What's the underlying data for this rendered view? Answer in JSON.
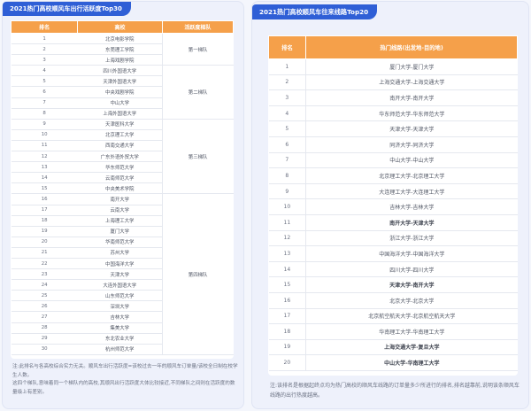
{
  "left": {
    "banner": "2021热门高校顺风车出行活跃度Top30",
    "headers": {
      "rank": "排名",
      "school": "高校",
      "tier": "活跃度梯队"
    },
    "rows": [
      {
        "rank": "1",
        "school": "北京电影学院"
      },
      {
        "rank": "2",
        "school": "东莞理工学院"
      },
      {
        "rank": "3",
        "school": "上海戏剧学院"
      },
      {
        "rank": "4",
        "school": "四川外国语大学"
      },
      {
        "rank": "5",
        "school": "天津外国语大学"
      },
      {
        "rank": "6",
        "school": "中央戏剧学院"
      },
      {
        "rank": "7",
        "school": "中山大学"
      },
      {
        "rank": "8",
        "school": "上海外国语大学"
      },
      {
        "rank": "9",
        "school": "天津医科大学"
      },
      {
        "rank": "10",
        "school": "北京理工大学"
      },
      {
        "rank": "11",
        "school": "西南交通大学"
      },
      {
        "rank": "12",
        "school": "广东外语外贸大学"
      },
      {
        "rank": "13",
        "school": "华东师范大学"
      },
      {
        "rank": "14",
        "school": "云南师范大学"
      },
      {
        "rank": "15",
        "school": "中央美术学院"
      },
      {
        "rank": "16",
        "school": "南开大学"
      },
      {
        "rank": "17",
        "school": "云南大学"
      },
      {
        "rank": "18",
        "school": "上海理工大学"
      },
      {
        "rank": "19",
        "school": "厦门大学"
      },
      {
        "rank": "20",
        "school": "华南师范大学"
      },
      {
        "rank": "21",
        "school": "苏州大学"
      },
      {
        "rank": "22",
        "school": "中国海洋大学"
      },
      {
        "rank": "23",
        "school": "天津大学"
      },
      {
        "rank": "24",
        "school": "大连外国语大学"
      },
      {
        "rank": "25",
        "school": "山东师范大学"
      },
      {
        "rank": "26",
        "school": "深圳大学"
      },
      {
        "rank": "27",
        "school": "吉林大学"
      },
      {
        "rank": "28",
        "school": "集美大学"
      },
      {
        "rank": "29",
        "school": "东北农业大学"
      },
      {
        "rank": "30",
        "school": "杭州师范大学"
      }
    ],
    "tiers": [
      {
        "label": "第一梯队",
        "span": 3
      },
      {
        "label": "第二梯队",
        "span": 5
      },
      {
        "label": "第三梯队",
        "span": 7
      },
      {
        "label": "第四梯队",
        "span": 15
      }
    ],
    "note": [
      "注:此排名与各高校综合实力无关。顺风车出行活跃度=该校过去一年的顺风车订单量/该校全日制在校学生人数。",
      "这四个梯队,意味着同一个梯队内的高校,其顺风出行活跃度大体比较接近,不同梯队之间则在活跃度的数量级上有差别。"
    ]
  },
  "right": {
    "banner": "2021热门高校顺风车往来线路Top20",
    "headers": {
      "rank": "排名",
      "route": "热门线路(出发地-目的地)"
    },
    "rows": [
      {
        "rank": "1",
        "route": "厦门大学-厦门大学",
        "bold": false
      },
      {
        "rank": "2",
        "route": "上海交通大学-上海交通大学",
        "bold": false
      },
      {
        "rank": "3",
        "route": "南开大学-南开大学",
        "bold": false
      },
      {
        "rank": "4",
        "route": "华东师范大学-华东师范大学",
        "bold": false
      },
      {
        "rank": "5",
        "route": "天津大学-天津大学",
        "bold": false
      },
      {
        "rank": "6",
        "route": "同济大学-同济大学",
        "bold": false
      },
      {
        "rank": "7",
        "route": "中山大学-中山大学",
        "bold": false
      },
      {
        "rank": "8",
        "route": "北京理工大学-北京理工大学",
        "bold": false
      },
      {
        "rank": "9",
        "route": "大连理工大学-大连理工大学",
        "bold": false
      },
      {
        "rank": "10",
        "route": "吉林大学-吉林大学",
        "bold": false
      },
      {
        "rank": "11",
        "route": "南开大学-天津大学",
        "bold": true
      },
      {
        "rank": "12",
        "route": "浙江大学-浙江大学",
        "bold": false
      },
      {
        "rank": "13",
        "route": "中国海洋大学-中国海洋大学",
        "bold": false
      },
      {
        "rank": "14",
        "route": "四川大学-四川大学",
        "bold": false
      },
      {
        "rank": "15",
        "route": "天津大学-南开大学",
        "bold": true
      },
      {
        "rank": "16",
        "route": "北京大学-北京大学",
        "bold": false
      },
      {
        "rank": "17",
        "route": "北京航空航天大学-北京航空航天大学",
        "bold": false
      },
      {
        "rank": "18",
        "route": "华南理工大学-华南理工大学",
        "bold": false
      },
      {
        "rank": "19",
        "route": "上海交通大学-复旦大学",
        "bold": true
      },
      {
        "rank": "20",
        "route": "中山大学-华南理工大学",
        "bold": true
      }
    ],
    "note": "注:该排名是根据起终点均为热门高校的顺风车线路的订单量多少所进行的排名,排名越靠前,说明该条顺风车线路的出行热度越高。"
  },
  "colors": {
    "banner": "#2f5fd6",
    "table_header": "#f5a04a",
    "panel_bg": "#eef1fb"
  },
  "chart_data": [
    {
      "type": "table",
      "title": "2021热门高校顺风车出行活跃度Top30",
      "columns": [
        "排名",
        "高校",
        "活跃度梯队"
      ],
      "rows": [
        [
          "1",
          "北京电影学院",
          "第一梯队"
        ],
        [
          "2",
          "东莞理工学院",
          "第一梯队"
        ],
        [
          "3",
          "上海戏剧学院",
          "第一梯队"
        ],
        [
          "4",
          "四川外国语大学",
          "第二梯队"
        ],
        [
          "5",
          "天津外国语大学",
          "第二梯队"
        ],
        [
          "6",
          "中央戏剧学院",
          "第二梯队"
        ],
        [
          "7",
          "中山大学",
          "第二梯队"
        ],
        [
          "8",
          "上海外国语大学",
          "第二梯队"
        ],
        [
          "9",
          "天津医科大学",
          "第三梯队"
        ],
        [
          "10",
          "北京理工大学",
          "第三梯队"
        ],
        [
          "11",
          "西南交通大学",
          "第三梯队"
        ],
        [
          "12",
          "广东外语外贸大学",
          "第三梯队"
        ],
        [
          "13",
          "华东师范大学",
          "第三梯队"
        ],
        [
          "14",
          "云南师范大学",
          "第三梯队"
        ],
        [
          "15",
          "中央美术学院",
          "第三梯队"
        ],
        [
          "16",
          "南开大学",
          "第四梯队"
        ],
        [
          "17",
          "云南大学",
          "第四梯队"
        ],
        [
          "18",
          "上海理工大学",
          "第四梯队"
        ],
        [
          "19",
          "厦门大学",
          "第四梯队"
        ],
        [
          "20",
          "华南师范大学",
          "第四梯队"
        ],
        [
          "21",
          "苏州大学",
          "第四梯队"
        ],
        [
          "22",
          "中国海洋大学",
          "第四梯队"
        ],
        [
          "23",
          "天津大学",
          "第四梯队"
        ],
        [
          "24",
          "大连外国语大学",
          "第四梯队"
        ],
        [
          "25",
          "山东师范大学",
          "第四梯队"
        ],
        [
          "26",
          "深圳大学",
          "第四梯队"
        ],
        [
          "27",
          "吉林大学",
          "第四梯队"
        ],
        [
          "28",
          "集美大学",
          "第四梯队"
        ],
        [
          "29",
          "东北农业大学",
          "第四梯队"
        ],
        [
          "30",
          "杭州师范大学",
          "第四梯队"
        ]
      ]
    },
    {
      "type": "table",
      "title": "2021热门高校顺风车往来线路Top20",
      "columns": [
        "排名",
        "热门线路(出发地-目的地)"
      ],
      "rows": [
        [
          "1",
          "厦门大学-厦门大学"
        ],
        [
          "2",
          "上海交通大学-上海交通大学"
        ],
        [
          "3",
          "南开大学-南开大学"
        ],
        [
          "4",
          "华东师范大学-华东师范大学"
        ],
        [
          "5",
          "天津大学-天津大学"
        ],
        [
          "6",
          "同济大学-同济大学"
        ],
        [
          "7",
          "中山大学-中山大学"
        ],
        [
          "8",
          "北京理工大学-北京理工大学"
        ],
        [
          "9",
          "大连理工大学-大连理工大学"
        ],
        [
          "10",
          "吉林大学-吉林大学"
        ],
        [
          "11",
          "南开大学-天津大学"
        ],
        [
          "12",
          "浙江大学-浙江大学"
        ],
        [
          "13",
          "中国海洋大学-中国海洋大学"
        ],
        [
          "14",
          "四川大学-四川大学"
        ],
        [
          "15",
          "天津大学-南开大学"
        ],
        [
          "16",
          "北京大学-北京大学"
        ],
        [
          "17",
          "北京航空航天大学-北京航空航天大学"
        ],
        [
          "18",
          "华南理工大学-华南理工大学"
        ],
        [
          "19",
          "上海交通大学-复旦大学"
        ],
        [
          "20",
          "中山大学-华南理工大学"
        ]
      ]
    }
  ]
}
